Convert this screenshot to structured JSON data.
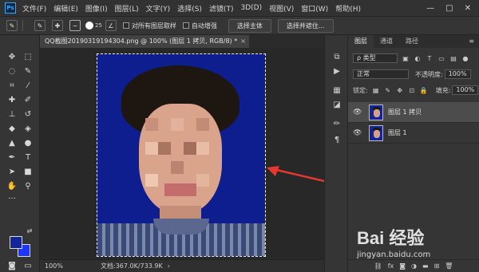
{
  "menubar": {
    "logo": "Ps",
    "items": [
      "文件(F)",
      "编辑(E)",
      "图像(I)",
      "图层(L)",
      "文字(Y)",
      "选择(S)",
      "滤镜(T)",
      "3D(D)",
      "视图(V)",
      "窗口(W)",
      "帮助(H)"
    ],
    "window_controls": [
      "—",
      "□",
      "✕"
    ]
  },
  "options": {
    "brush_size": "25",
    "sample_all_label": "对所有图层取样",
    "auto_enhance_label": "自动增强",
    "select_subject": "选择主体",
    "select_and_mask": "选择并遮住..."
  },
  "document": {
    "tab_title": "QQ截图20190319194304.png @ 100% (图层 1 拷贝, RGB/8) *",
    "zoom": "100%",
    "doc_info": "文档:367.0K/733.9K"
  },
  "colors": {
    "foreground": "#14259b",
    "background": "#1d35ff",
    "canvas_bg": "#0f1e8e",
    "arrow": "#e8382d"
  },
  "layers_panel": {
    "tabs": [
      "图层",
      "通道",
      "路径"
    ],
    "filter_label": "ρ 类型",
    "blend_mode": "正常",
    "opacity_label": "不透明度:",
    "opacity_value": "100%",
    "lock_label": "锁定:",
    "fill_label": "填充:",
    "fill_value": "100%",
    "layers": [
      {
        "name": "图层 1 拷贝",
        "selected": true,
        "visible": true
      },
      {
        "name": "图层 1",
        "selected": false,
        "visible": true
      }
    ],
    "footer_icons": [
      "link-icon",
      "fx-icon",
      "mask-icon",
      "adjustment-icon",
      "group-icon",
      "new-layer-icon",
      "trash-icon"
    ]
  },
  "watermark": {
    "brand": "Bai 经验",
    "url": "jingyan.baidu.com"
  }
}
